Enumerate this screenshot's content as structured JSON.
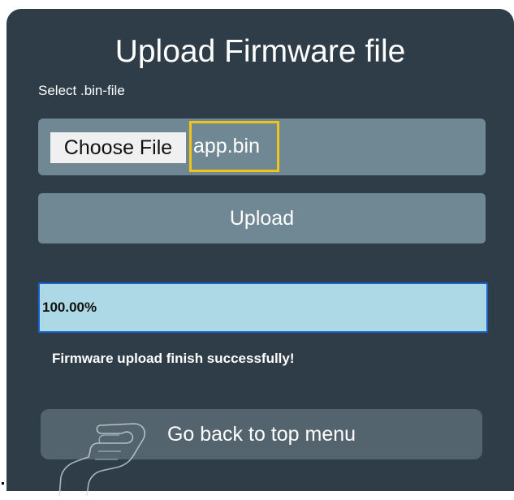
{
  "header": {
    "title": "Upload Firmware file",
    "subtitle": "Select .bin-file"
  },
  "file_picker": {
    "choose_label": "Choose File",
    "file_name": "app.bin"
  },
  "upload": {
    "label": "Upload"
  },
  "progress": {
    "value": 1.0,
    "label": "100.00%"
  },
  "status": {
    "message": "Firmware upload finish successfully!"
  },
  "navigation": {
    "back_label": "Go back to top menu"
  },
  "colors": {
    "panel_bg": "#2e3d47",
    "control_bg": "#6f8893",
    "back_button_bg": "#53646f",
    "progress_fill": "#add8e6",
    "progress_border": "#1a62cc",
    "highlight_border": "#f2c413"
  },
  "icons": {
    "pointer": "pointing-hand-icon"
  }
}
